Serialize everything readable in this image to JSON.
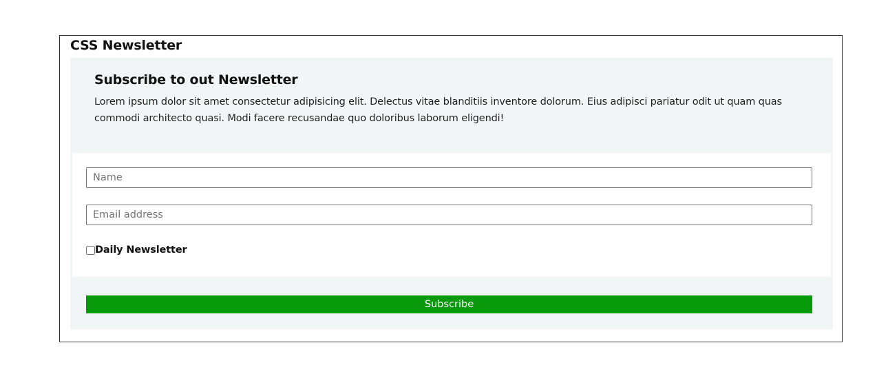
{
  "page": {
    "title": "CSS Newsletter"
  },
  "newsletter": {
    "heading": "Subscribe to out Newsletter",
    "description": "Lorem ipsum dolor sit amet consectetur adipisicing elit. Delectus vitae blanditiis inventore dolorum. Eius adipisci pariatur odit ut quam quas commodi architecto quasi. Modi facere recusandae quo doloribus laborum eligendi!"
  },
  "form": {
    "name_placeholder": "Name",
    "name_value": "",
    "email_placeholder": "Email address",
    "email_value": "",
    "daily_label": "Daily Newsletter",
    "daily_checked": false,
    "subscribe_label": "Subscribe"
  },
  "colors": {
    "card_background": "#f1f5f5",
    "button_background": "#099a0c",
    "button_text": "#ffffff"
  }
}
